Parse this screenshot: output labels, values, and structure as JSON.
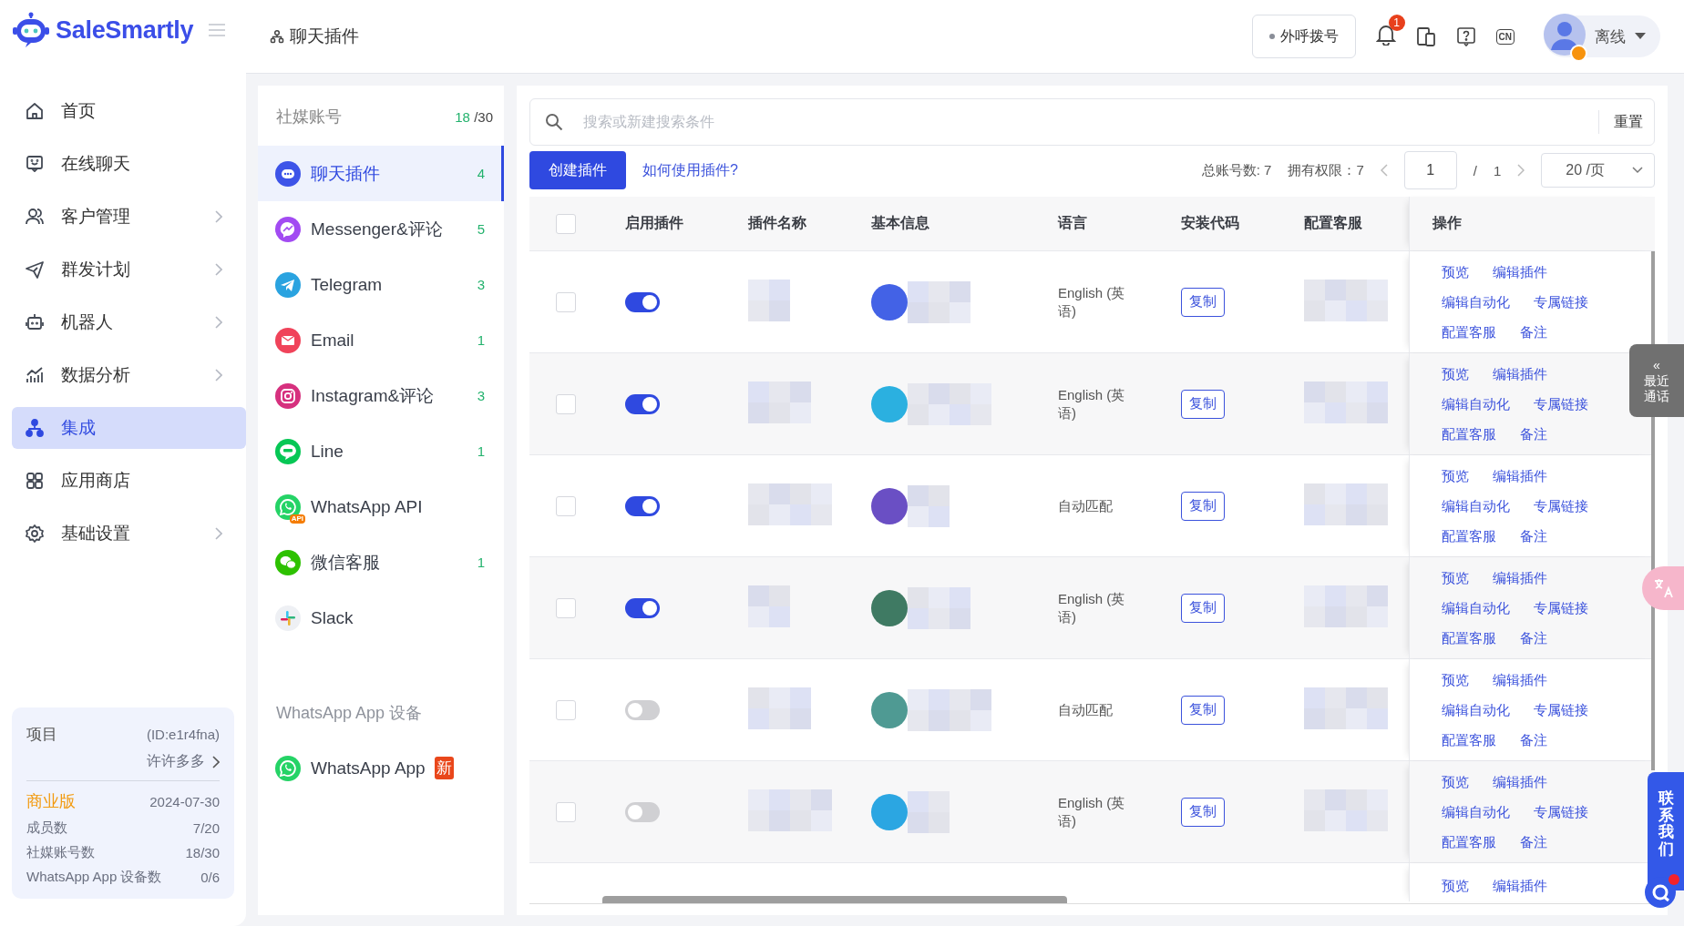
{
  "sidebar": {
    "logo": "SaleSmartly",
    "nav": [
      {
        "label": "首页",
        "expandable": false,
        "selected": false
      },
      {
        "label": "在线聊天",
        "expandable": false,
        "selected": false
      },
      {
        "label": "客户管理",
        "expandable": true,
        "selected": false
      },
      {
        "label": "群发计划",
        "expandable": true,
        "selected": false
      },
      {
        "label": "机器人",
        "expandable": true,
        "selected": false
      },
      {
        "label": "数据分析",
        "expandable": true,
        "selected": false
      },
      {
        "label": "集成",
        "expandable": false,
        "selected": true
      },
      {
        "label": "应用商店",
        "expandable": false,
        "selected": false
      },
      {
        "label": "基础设置",
        "expandable": true,
        "selected": false
      }
    ]
  },
  "project_card": {
    "title": "项目",
    "id": "(ID:e1r4fna)",
    "owner": "许许多多",
    "plan": "商业版",
    "expiry": "2024-07-30",
    "stats": [
      {
        "label": "成员数",
        "value": "7/20"
      },
      {
        "label": "社媒账号数",
        "value": "18/30"
      },
      {
        "label": "WhatsApp App 设备数",
        "value": "0/6"
      }
    ]
  },
  "header": {
    "breadcrumb": "聊天插件",
    "dial_button": "外呼拨号",
    "notification_count": "1",
    "language_badge": "CN",
    "user_status": "离线"
  },
  "accounts": {
    "title": "社媒账号",
    "used": "18",
    "quota": "/30",
    "items": [
      {
        "label": "聊天插件",
        "count": "4",
        "selected": true
      },
      {
        "label": "Messenger&评论",
        "count": "5",
        "selected": false
      },
      {
        "label": "Telegram",
        "count": "3",
        "selected": false
      },
      {
        "label": "Email",
        "count": "1",
        "selected": false
      },
      {
        "label": "Instagram&评论",
        "count": "3",
        "selected": false
      },
      {
        "label": "Line",
        "count": "1",
        "selected": false
      },
      {
        "label": "WhatsApp API",
        "badge": "API",
        "selected": false
      },
      {
        "label": "微信客服",
        "count": "1",
        "selected": false
      },
      {
        "label": "Slack",
        "selected": false
      }
    ],
    "device_section": {
      "title": "WhatsApp App 设备",
      "items": [
        {
          "label": "WhatsApp App",
          "badge": "新",
          "selected": false
        }
      ]
    }
  },
  "search": {
    "placeholder": "搜索或新建搜索条件",
    "reset": "重置"
  },
  "toolbar": {
    "create_button": "创建插件",
    "help_link": "如何使用插件?",
    "total": "总账号数: 7",
    "permitted": "拥有权限：7",
    "page": "1",
    "separator": "/",
    "page_count": "1",
    "page_size": "20 /页"
  },
  "table": {
    "header_checked": false,
    "columns": [
      "启用插件",
      "插件名称",
      "基本信息",
      "语言",
      "安装代码",
      "配置客服",
      "操作"
    ],
    "rows": [
      {
        "checked": false,
        "enabled": true,
        "color": "#4362e6",
        "language": "English (英语)",
        "copy": "复制",
        "actions": [
          "预览",
          "编辑插件",
          "编辑自动化",
          "专属链接",
          "配置客服",
          "备注"
        ]
      },
      {
        "checked": false,
        "enabled": true,
        "color": "#2bb0e0",
        "language": "English (英语)",
        "copy": "复制",
        "actions": [
          "预览",
          "编辑插件",
          "编辑自动化",
          "专属链接",
          "配置客服",
          "备注"
        ]
      },
      {
        "checked": false,
        "enabled": true,
        "color": "#6a4fc4",
        "language": "自动匹配",
        "copy": "复制",
        "actions": [
          "预览",
          "编辑插件",
          "编辑自动化",
          "专属链接",
          "配置客服",
          "备注"
        ]
      },
      {
        "checked": false,
        "enabled": true,
        "color": "#3f7a63",
        "language": "English (英语)",
        "copy": "复制",
        "actions": [
          "预览",
          "编辑插件",
          "编辑自动化",
          "专属链接",
          "配置客服",
          "备注"
        ]
      },
      {
        "checked": false,
        "enabled": false,
        "color": "#4f9a93",
        "language": "自动匹配",
        "copy": "复制",
        "actions": [
          "预览",
          "编辑插件",
          "编辑自动化",
          "专属链接",
          "配置客服",
          "备注"
        ]
      },
      {
        "checked": false,
        "enabled": false,
        "color": "#2ba6e2",
        "language": "English (英语)",
        "copy": "复制",
        "actions": [
          "预览",
          "编辑插件",
          "编辑自动化",
          "专属链接",
          "配置客服",
          "备注"
        ]
      }
    ],
    "partial_row_actions": [
      "预览",
      "编辑插件"
    ]
  },
  "floating": {
    "recent_calls_arrow": "«",
    "recent_calls": "最近通话",
    "contact_us": "联系我们"
  }
}
